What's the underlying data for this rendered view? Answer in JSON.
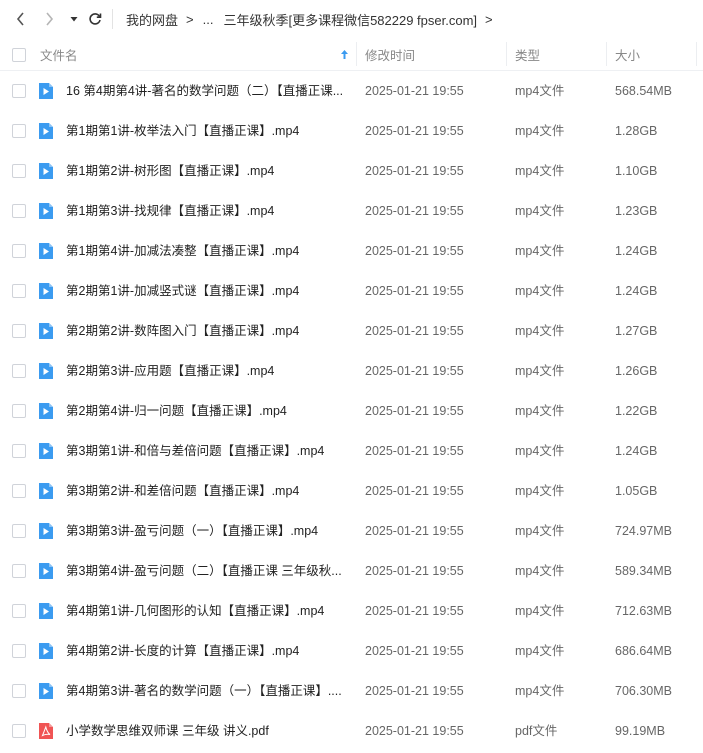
{
  "breadcrumb": {
    "root": "我的网盘",
    "ellipsis": "...",
    "current": "三年级秋季[更多课程微信582229 fpser.com]"
  },
  "header": {
    "name": "文件名",
    "modified": "修改时间",
    "type": "类型",
    "size": "大小"
  },
  "files": [
    {
      "name": "16 第4期第4讲-著名的数学问题（二）【直播正课...",
      "time": "2025-01-21 19:55",
      "type": "mp4文件",
      "size": "568.54MB",
      "kind": "video"
    },
    {
      "name": "第1期第1讲-枚举法入门【直播正课】.mp4",
      "time": "2025-01-21 19:55",
      "type": "mp4文件",
      "size": "1.28GB",
      "kind": "video"
    },
    {
      "name": "第1期第2讲-树形图【直播正课】.mp4",
      "time": "2025-01-21 19:55",
      "type": "mp4文件",
      "size": "1.10GB",
      "kind": "video"
    },
    {
      "name": "第1期第3讲-找规律【直播正课】.mp4",
      "time": "2025-01-21 19:55",
      "type": "mp4文件",
      "size": "1.23GB",
      "kind": "video"
    },
    {
      "name": "第1期第4讲-加减法凑整【直播正课】.mp4",
      "time": "2025-01-21 19:55",
      "type": "mp4文件",
      "size": "1.24GB",
      "kind": "video"
    },
    {
      "name": "第2期第1讲-加减竖式谜【直播正课】.mp4",
      "time": "2025-01-21 19:55",
      "type": "mp4文件",
      "size": "1.24GB",
      "kind": "video"
    },
    {
      "name": "第2期第2讲-数阵图入门【直播正课】.mp4",
      "time": "2025-01-21 19:55",
      "type": "mp4文件",
      "size": "1.27GB",
      "kind": "video"
    },
    {
      "name": "第2期第3讲-应用题【直播正课】.mp4",
      "time": "2025-01-21 19:55",
      "type": "mp4文件",
      "size": "1.26GB",
      "kind": "video"
    },
    {
      "name": "第2期第4讲-归一问题【直播正课】.mp4",
      "time": "2025-01-21 19:55",
      "type": "mp4文件",
      "size": "1.22GB",
      "kind": "video"
    },
    {
      "name": "第3期第1讲-和倍与差倍问题【直播正课】.mp4",
      "time": "2025-01-21 19:55",
      "type": "mp4文件",
      "size": "1.24GB",
      "kind": "video"
    },
    {
      "name": "第3期第2讲-和差倍问题【直播正课】.mp4",
      "time": "2025-01-21 19:55",
      "type": "mp4文件",
      "size": "1.05GB",
      "kind": "video"
    },
    {
      "name": "第3期第3讲-盈亏问题（一）【直播正课】.mp4",
      "time": "2025-01-21 19:55",
      "type": "mp4文件",
      "size": "724.97MB",
      "kind": "video"
    },
    {
      "name": "第3期第4讲-盈亏问题（二）【直播正课 三年级秋...",
      "time": "2025-01-21 19:55",
      "type": "mp4文件",
      "size": "589.34MB",
      "kind": "video"
    },
    {
      "name": "第4期第1讲-几何图形的认知【直播正课】.mp4",
      "time": "2025-01-21 19:55",
      "type": "mp4文件",
      "size": "712.63MB",
      "kind": "video"
    },
    {
      "name": "第4期第2讲-长度的计算【直播正课】.mp4",
      "time": "2025-01-21 19:55",
      "type": "mp4文件",
      "size": "686.64MB",
      "kind": "video"
    },
    {
      "name": "第4期第3讲-著名的数学问题（一）【直播正课】....",
      "time": "2025-01-21 19:55",
      "type": "mp4文件",
      "size": "706.30MB",
      "kind": "video"
    },
    {
      "name": "小学数学思维双师课 三年级 讲义.pdf",
      "time": "2025-01-21 19:55",
      "type": "pdf文件",
      "size": "99.19MB",
      "kind": "pdf"
    }
  ],
  "colors": {
    "video_icon": "#3b9bf0",
    "pdf_icon": "#f05454",
    "sort_arrow": "#3b9bf0"
  },
  "icons": {
    "back": "chevron-left-icon",
    "forward": "chevron-right-icon",
    "history": "caret-down-icon",
    "refresh": "refresh-icon",
    "sort": "sort-asc-icon"
  }
}
